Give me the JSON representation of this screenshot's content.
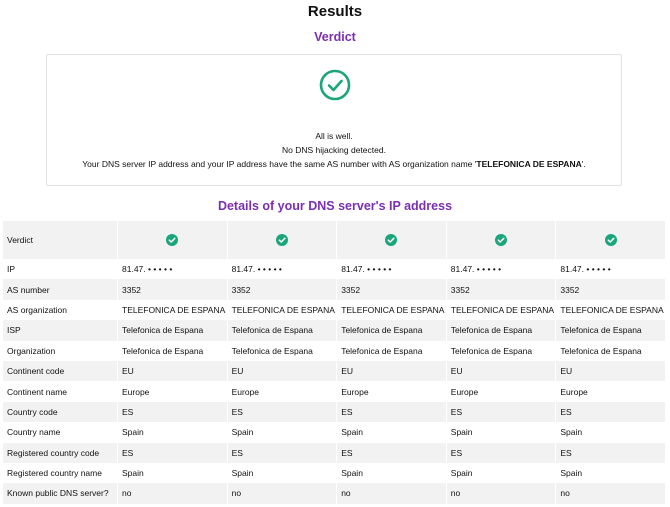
{
  "header": {
    "title": "Results",
    "verdict_heading": "Verdict"
  },
  "verdict": {
    "icon": "check-circle-icon",
    "line1": "All is well.",
    "line2": "No DNS hijacking detected.",
    "line3_prefix": "Your DNS server IP address and your IP address have the same AS number with AS organization name '",
    "line3_org": "TELEFONICA DE ESPANA",
    "line3_suffix": "'.",
    "accent_color": "#1aa67a"
  },
  "details": {
    "title": "Details of your DNS server's IP address",
    "rows": [
      {
        "label": "Verdict",
        "type": "check",
        "values": [
          "check-circle-icon",
          "check-circle-icon",
          "check-circle-icon",
          "check-circle-icon",
          "check-circle-icon"
        ]
      },
      {
        "label": "IP",
        "values": [
          "81.47. • • • • •",
          "81.47. • • • • •",
          "81.47. • • • • •",
          "81.47. • • • • •",
          "81.47. • • • • •"
        ]
      },
      {
        "label": "AS number",
        "values": [
          "3352",
          "3352",
          "3352",
          "3352",
          "3352"
        ]
      },
      {
        "label": "AS organization",
        "values": [
          "TELEFONICA DE ESPANA",
          "TELEFONICA DE ESPANA",
          "TELEFONICA DE ESPANA",
          "TELEFONICA DE ESPANA",
          "TELEFONICA DE ESPANA"
        ]
      },
      {
        "label": "ISP",
        "values": [
          "Telefonica de Espana",
          "Telefonica de Espana",
          "Telefonica de Espana",
          "Telefonica de Espana",
          "Telefonica de Espana"
        ]
      },
      {
        "label": "Organization",
        "values": [
          "Telefonica de Espana",
          "Telefonica de Espana",
          "Telefonica de Espana",
          "Telefonica de Espana",
          "Telefonica de Espana"
        ]
      },
      {
        "label": "Continent code",
        "values": [
          "EU",
          "EU",
          "EU",
          "EU",
          "EU"
        ]
      },
      {
        "label": "Continent name",
        "values": [
          "Europe",
          "Europe",
          "Europe",
          "Europe",
          "Europe"
        ]
      },
      {
        "label": "Country code",
        "values": [
          "ES",
          "ES",
          "ES",
          "ES",
          "ES"
        ]
      },
      {
        "label": "Country name",
        "values": [
          "Spain",
          "Spain",
          "Spain",
          "Spain",
          "Spain"
        ]
      },
      {
        "label": "Registered country code",
        "values": [
          "ES",
          "ES",
          "ES",
          "ES",
          "ES"
        ]
      },
      {
        "label": "Registered country name",
        "values": [
          "Spain",
          "Spain",
          "Spain",
          "Spain",
          "Spain"
        ]
      },
      {
        "label": "Known public DNS server?",
        "values": [
          "no",
          "no",
          "no",
          "no",
          "no"
        ]
      }
    ]
  }
}
